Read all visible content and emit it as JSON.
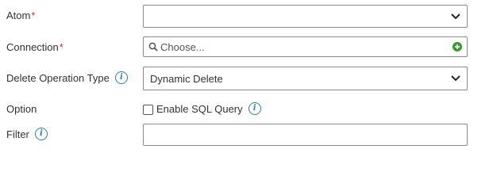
{
  "form": {
    "atom": {
      "label": "Atom",
      "required_mark": "*",
      "value": ""
    },
    "connection": {
      "label": "Connection",
      "required_mark": "*",
      "placeholder": "Choose..."
    },
    "delete_operation_type": {
      "label": "Delete Operation Type",
      "value": "Dynamic Delete"
    },
    "option": {
      "label": "Option",
      "checkbox_label": "Enable SQL Query",
      "checked": false
    },
    "filter": {
      "label": "Filter",
      "value": ""
    }
  },
  "icons": {
    "info": "info-icon",
    "search": "search-icon",
    "add": "add-circle-icon",
    "dropdown": "chevron-down-icon"
  },
  "colors": {
    "required": "#c0392b",
    "info": "#2a7fa8",
    "add": "#3a9a2a",
    "border": "#8a8a8a"
  }
}
